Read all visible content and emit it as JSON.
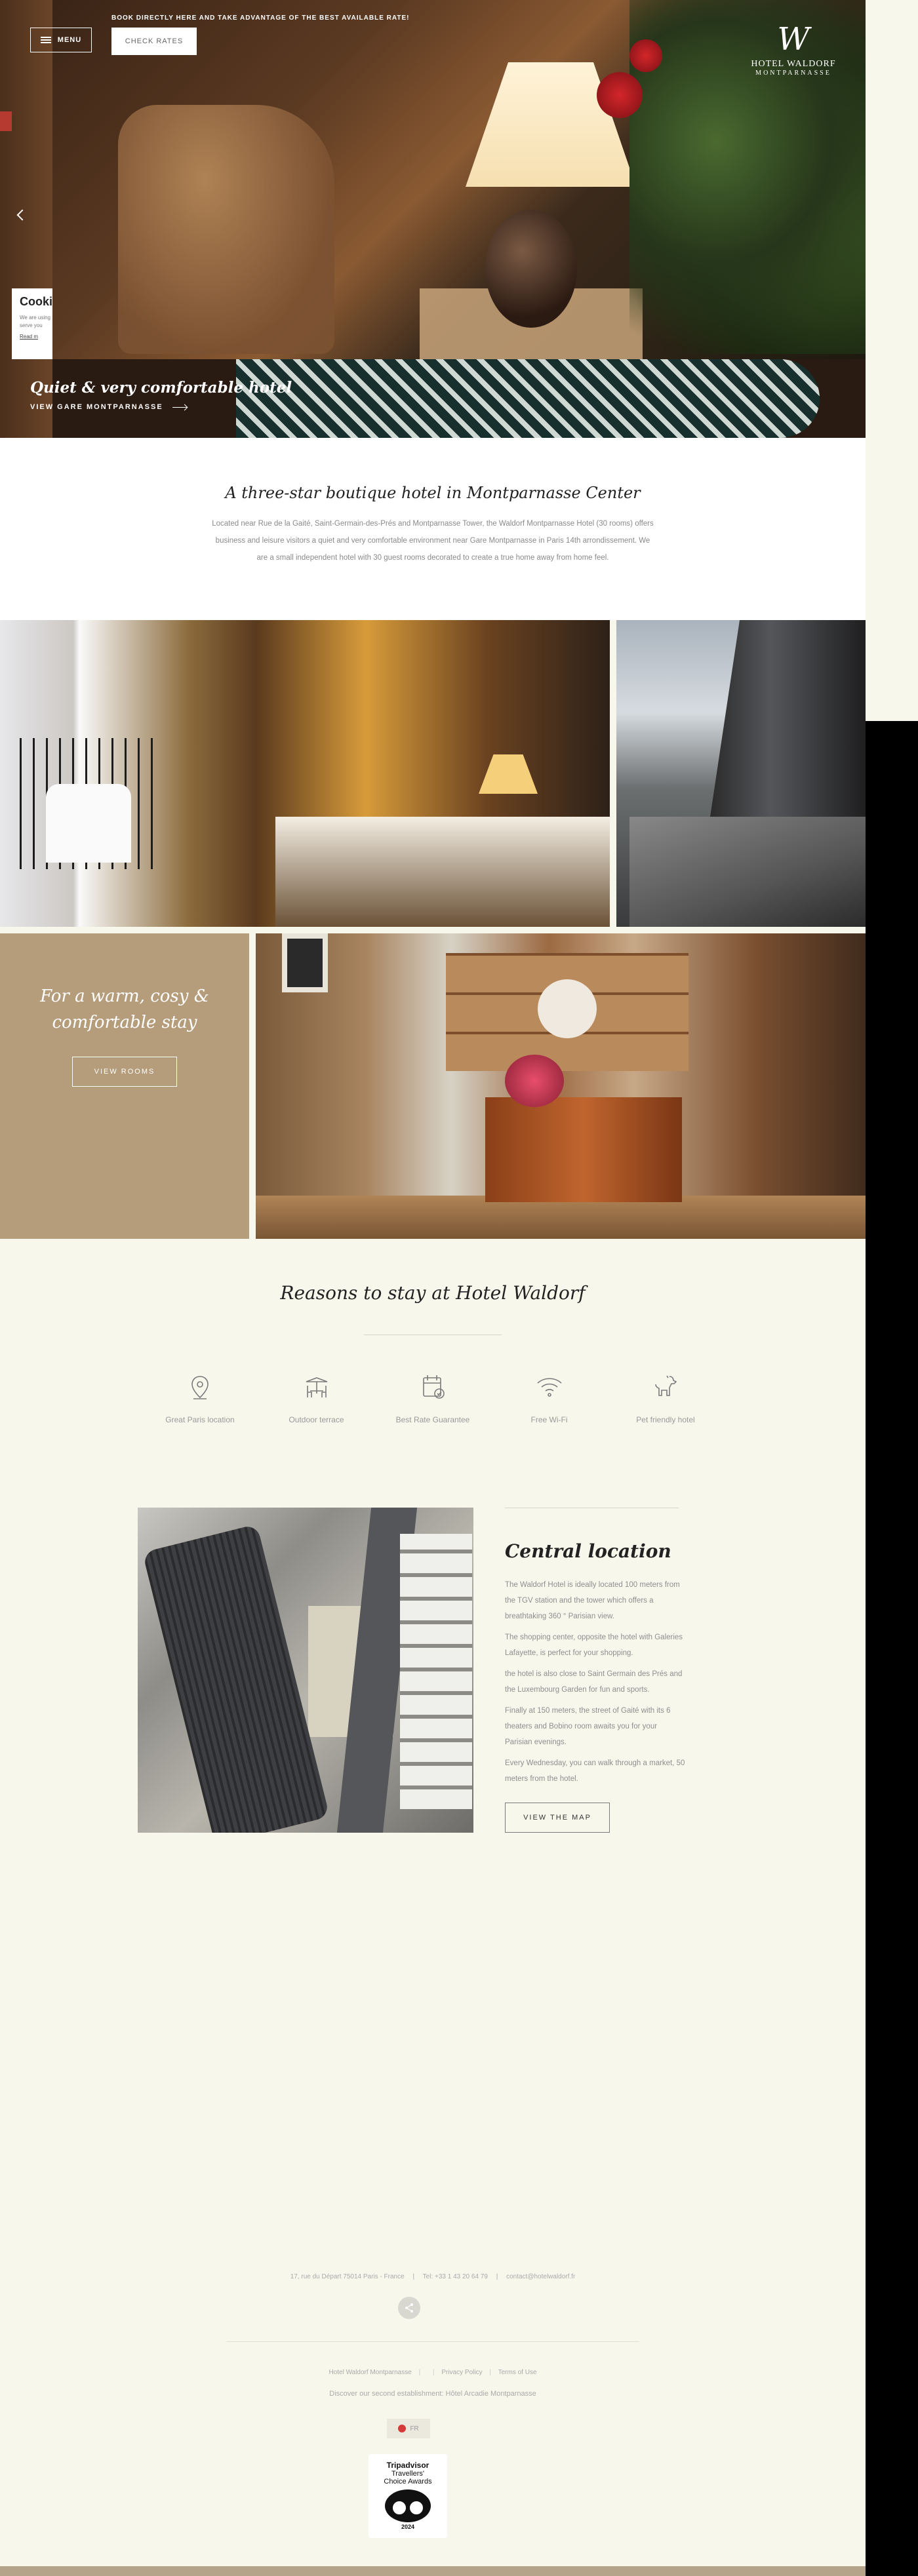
{
  "header": {
    "menu_label": "MENU",
    "promo_text": "BOOK DIRECTLY HERE AND TAKE ADVANTAGE OF THE BEST AVAILABLE RATE!",
    "check_rates_label": "CHECK RATES",
    "logo_mark": "W",
    "logo_name": "HOTEL WALDORF",
    "logo_sub": "MONTPARNASSE"
  },
  "hero": {
    "caption": "Quiet & very comfortable hotel",
    "link_label": "VIEW GARE MONTPARNASSE"
  },
  "cookie": {
    "title": "Cookies",
    "text_line1": "We are using",
    "text_line2": "serve you",
    "link": "Read m"
  },
  "intro": {
    "title": "A three-star boutique hotel in Montparnasse Center",
    "text": "Located near Rue de la Gaité, Saint-Germain-des-Prés and Montparnasse Tower, the Waldorf Montparnasse Hotel (30 rooms) offers business and leisure visitors a quiet and very comfortable environment near Gare Montparnasse in Paris 14th arrondissement. We are a small independent hotel with 30 guest rooms decorated to create a true home away from home feel."
  },
  "promo_block": {
    "title_line1": "For a warm, cosy &",
    "title_line2": "comfortable stay",
    "button_label": "VIEW ROOMS"
  },
  "reasons": {
    "title": "Reasons to stay at Hotel Waldorf",
    "items": [
      {
        "label": "Great Paris location",
        "icon": "location-pin-icon"
      },
      {
        "label": "Outdoor terrace",
        "icon": "terrace-icon"
      },
      {
        "label": "Best Rate Guarantee",
        "icon": "calendar-check-icon"
      },
      {
        "label": "Free Wi-Fi",
        "icon": "wifi-icon"
      },
      {
        "label": "Pet friendly hotel",
        "icon": "dog-icon"
      }
    ]
  },
  "central": {
    "title": "Central location",
    "paragraphs": [
      "The Waldorf Hotel is ideally located 100 meters from the TGV station and the tower which offers a breathtaking 360 ° Parisian view.",
      "The shopping center, opposite the hotel with Galeries Lafayette, is perfect for your shopping.",
      "the hotel is also close to Saint Germain des Prés and the Luxembourg Garden for fun and sports.",
      "Finally at 150 meters, the street of Gaité with its 6 theaters and Bobino room awaits you for your Parisian evenings.",
      "Every Wednesday, you can walk through a market, 50 meters from the hotel."
    ],
    "button_label": "VIEW THE MAP"
  },
  "footer": {
    "address": "17, rue du Départ 75014 Paris - France",
    "phone": "Tel: +33 1 43 20 64 79",
    "email": "contact@hotelwaldorf.fr",
    "links": [
      "Hotel Waldorf Montparnasse",
      "",
      "Privacy Policy",
      "Terms of Use"
    ],
    "second_text": "Discover our second establishment: Hôtel Arcadie Montparnasse",
    "language": "FR",
    "tripadvisor_line1": "Tripadvisor",
    "tripadvisor_line2": "Travellers'",
    "tripadvisor_line3": "Choice Awards",
    "tripadvisor_year": "2024"
  },
  "colors": {
    "page_bg": "#f8f7ec",
    "accent_tan": "#b59c7a",
    "text_muted": "#8a8a8a"
  }
}
